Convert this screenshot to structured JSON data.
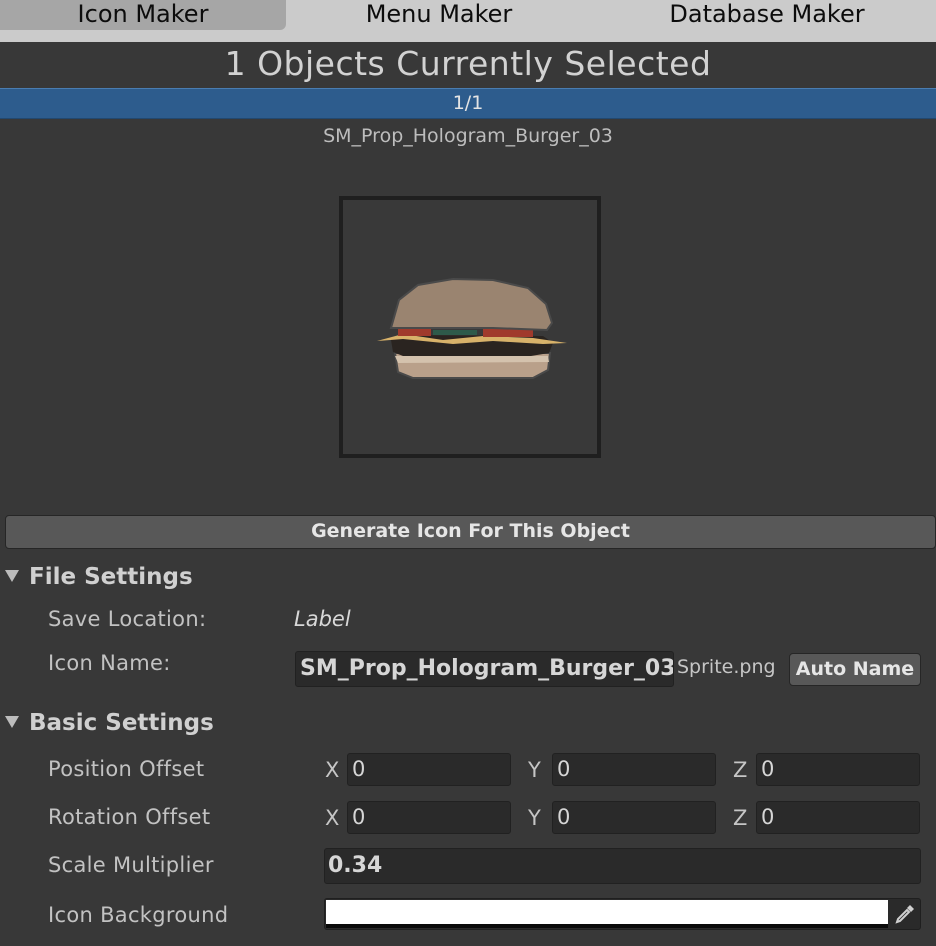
{
  "tabs": [
    {
      "label": "Icon Maker",
      "active": true
    },
    {
      "label": "Menu Maker",
      "active": false
    },
    {
      "label": "Database Maker",
      "active": false
    }
  ],
  "header": {
    "title": "1 Objects Currently Selected"
  },
  "progress": {
    "text": "1/1",
    "value": 1.0,
    "color": "#2d5c8d"
  },
  "object_name": "SM_Prop_Hologram_Burger_03",
  "generate_button": "Generate Icon For This Object",
  "file_settings": {
    "title": "File Settings",
    "save_location_label": "Save Location:",
    "save_location_value": "Label",
    "icon_name_label": "Icon Name:",
    "icon_name_value": "SM_Prop_Hologram_Burger_03",
    "icon_name_suffix": "Sprite.png",
    "auto_name_button": "Auto Name"
  },
  "basic_settings": {
    "title": "Basic Settings",
    "position_offset": {
      "label": "Position Offset",
      "x": "0",
      "y": "0",
      "z": "0"
    },
    "rotation_offset": {
      "label": "Rotation Offset",
      "x": "0",
      "y": "0",
      "z": "0"
    },
    "axis_labels": {
      "x": "X",
      "y": "Y",
      "z": "Z"
    },
    "scale_multiplier": {
      "label": "Scale Multiplier",
      "value": "0.34"
    },
    "icon_background": {
      "label": "Icon Background",
      "color": "#ffffff"
    }
  },
  "icons": {
    "foldout": "triangle-down-icon",
    "eyedropper": "eyedropper-icon",
    "preview": "burger-preview-image"
  }
}
